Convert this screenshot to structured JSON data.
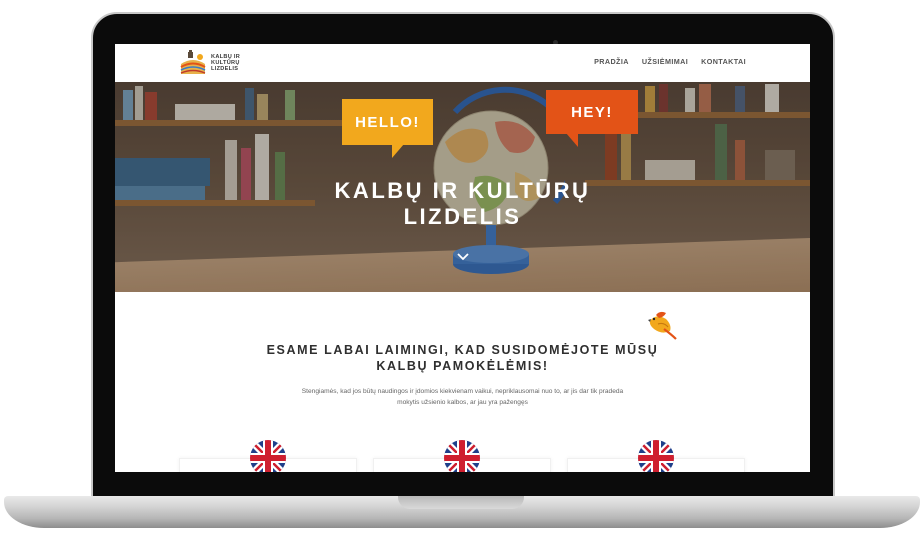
{
  "header": {
    "logo_line1": "KALBŲ IR",
    "logo_line2": "KULTŪRŲ",
    "logo_line3": "LIZDELIS",
    "nav": [
      {
        "label": "PRADŽIA"
      },
      {
        "label": "UŽSIĖMIMAI"
      },
      {
        "label": "KONTAKTAI"
      }
    ]
  },
  "hero": {
    "bubble_hello": "HELLO!",
    "bubble_hey": "HEY!",
    "title_line1": "KALBŲ IR KULTŪRŲ",
    "title_line2": "LIZDELIS"
  },
  "content": {
    "headline_line1": "ESAME LABAI LAIMINGI, KAD SUSIDOMĖJOTE MŪSŲ",
    "headline_line2": "KALBŲ PAMOKĖLĖMIS!",
    "subtext_line1": "Stengiamės, kad jos būtų naudingos ir įdomios kiekvienam vaikui, nepriklausomai nuo to, ar jis dar tik pradeda",
    "subtext_line2": "mokytis užsienio kalbos, ar jau yra pažengęs"
  },
  "colors": {
    "hello_bubble": "#f2a81d",
    "hey_bubble": "#e35317",
    "laptop_bezel": "#0b0b0b"
  },
  "icons": [
    "logo-icon",
    "chevron-down-icon",
    "bird-icon",
    "uk-flag-icon"
  ]
}
